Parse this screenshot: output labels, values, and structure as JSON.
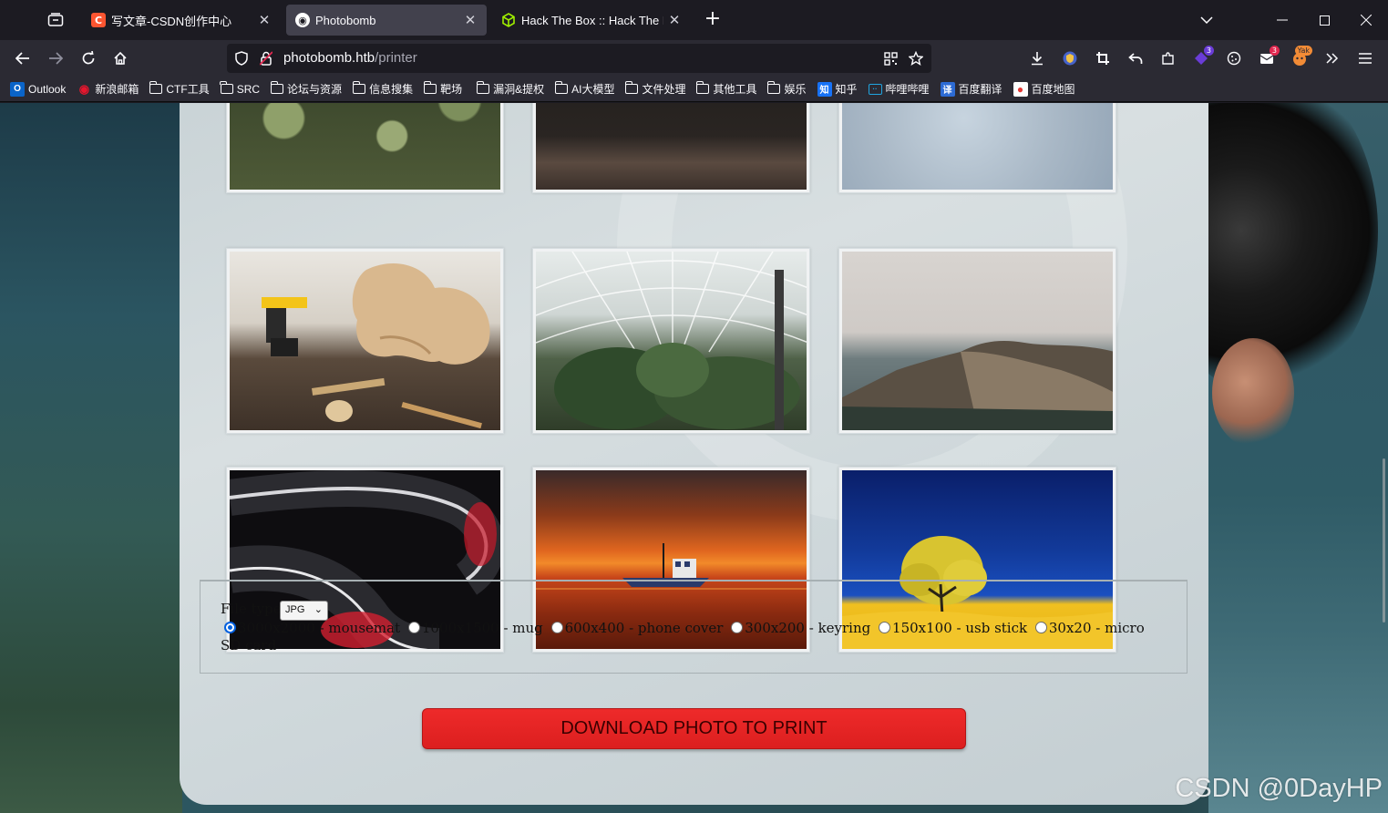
{
  "tabs": [
    {
      "title": "写文章-CSDN创作中心",
      "favicon": "C",
      "color": "#fc5531",
      "active": false
    },
    {
      "title": "Photobomb",
      "favicon": "P",
      "color": "#ffffff",
      "active": true
    },
    {
      "title": "Hack The Box :: Hack The Box",
      "favicon": "cube",
      "color": "#9fef00",
      "active": false
    }
  ],
  "url": {
    "host": "photobomb.htb",
    "path": "/printer"
  },
  "toolbar_badges": {
    "extension": "3",
    "mail": "3",
    "yak": "Yak"
  },
  "bookmarks": [
    {
      "label": "Outlook",
      "icon": "outlook-icon"
    },
    {
      "label": "新浪邮箱",
      "icon": "weibo-icon"
    },
    {
      "label": "CTF工具",
      "icon": "folder-icon"
    },
    {
      "label": "SRC",
      "icon": "folder-icon"
    },
    {
      "label": "论坛与资源",
      "icon": "folder-icon"
    },
    {
      "label": "信息搜集",
      "icon": "folder-icon"
    },
    {
      "label": "靶场",
      "icon": "folder-icon"
    },
    {
      "label": "漏洞&提权",
      "icon": "folder-icon"
    },
    {
      "label": "AI大模型",
      "icon": "folder-icon"
    },
    {
      "label": "文件处理",
      "icon": "folder-icon"
    },
    {
      "label": "其他工具",
      "icon": "folder-icon"
    },
    {
      "label": "娱乐",
      "icon": "folder-icon"
    },
    {
      "label": "知乎",
      "icon": "zhihu-icon"
    },
    {
      "label": "哔哩哔哩",
      "icon": "bilibili-icon"
    },
    {
      "label": "百度翻译",
      "icon": "baidu-translate-icon"
    },
    {
      "label": "百度地图",
      "icon": "baidu-map-icon"
    }
  ],
  "photos": [
    {
      "name": "plants-photo"
    },
    {
      "name": "keyboard-photo"
    },
    {
      "name": "lens-photo"
    },
    {
      "name": "workshop-guitar-photo"
    },
    {
      "name": "glasshouse-photo"
    },
    {
      "name": "coastline-photo"
    },
    {
      "name": "abstract-red-chrome-photo"
    },
    {
      "name": "boat-sunset-photo"
    },
    {
      "name": "yellow-tree-photo"
    }
  ],
  "form": {
    "file_type_label": "File type",
    "file_type_value": "JPG",
    "sizes": [
      {
        "label": "3000x2000 - mousemat",
        "selected": true
      },
      {
        "label": "1000x1500 - mug",
        "selected": false
      },
      {
        "label": "600x400 - phone cover",
        "selected": false
      },
      {
        "label": "300x200 - keyring",
        "selected": false
      },
      {
        "label": "150x100 - usb stick",
        "selected": false
      },
      {
        "label": "30x20 - micro SD card",
        "selected": false
      }
    ]
  },
  "download_label": "DOWNLOAD PHOTO TO PRINT",
  "watermark": "CSDN @0DayHP",
  "colors": {
    "download_button": "#e52424",
    "chrome_dark": "#1c1b22",
    "chrome_mid": "#2b2a33",
    "radio_selected": "#0060df"
  }
}
